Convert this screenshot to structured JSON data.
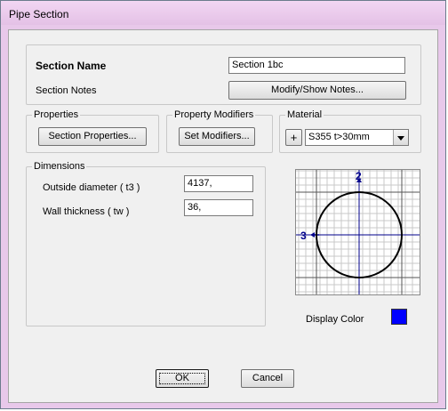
{
  "window": {
    "title": "Pipe Section"
  },
  "section": {
    "name_label": "Section Name",
    "name_value": "Section 1bc",
    "notes_label": "Section Notes",
    "notes_button": "Modify/Show Notes..."
  },
  "properties": {
    "legend": "Properties",
    "button": "Section Properties..."
  },
  "modifiers": {
    "legend": "Property Modifiers",
    "button": "Set Modifiers..."
  },
  "material": {
    "legend": "Material",
    "add_button": "+",
    "selected": "S355 t>30mm"
  },
  "dimensions": {
    "legend": "Dimensions",
    "outside_diameter_label": "Outside diameter  ( t3 )",
    "outside_diameter_value": "4137,",
    "wall_thickness_label": "Wall thickness  ( tw )",
    "wall_thickness_value": "36,"
  },
  "preview": {
    "axis2_label": "2",
    "axis3_label": "3"
  },
  "display_color": {
    "label": "Display Color",
    "color": "#0000ff"
  },
  "buttons": {
    "ok": "OK",
    "cancel": "Cancel"
  },
  "colors": {
    "window_frame": "#e8c8ea",
    "client": "#f0f0f0",
    "axis": "#00008b",
    "grid": "#c8c8c8"
  }
}
